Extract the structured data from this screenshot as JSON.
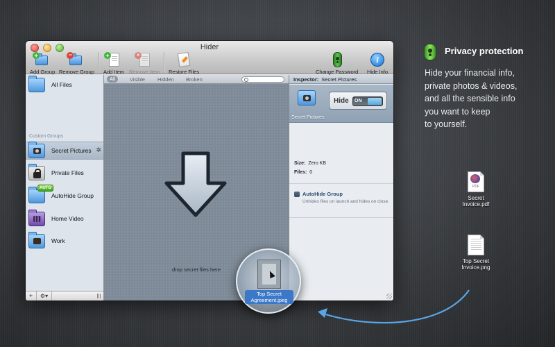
{
  "window": {
    "title": "Hider",
    "toolbar": {
      "add_group": "Add Group",
      "remove_group": "Remove Group",
      "add_item": "Add Item",
      "remove_item": "Remove Item",
      "restore_files": "Restore Files",
      "change_password": "Change Password",
      "hide_info": "Hide Info"
    },
    "sidebar": {
      "all_files": "All Files",
      "group_header": "Custom Groups",
      "items": [
        {
          "label": "Secret Pictures",
          "icon": "camera-folder-icon",
          "selected": true
        },
        {
          "label": "Private Files",
          "icon": "lock-folder-icon"
        },
        {
          "label": "AutoHide Group",
          "icon": "autohide-folder-icon",
          "badge": "AUTO"
        },
        {
          "label": "Home Video",
          "icon": "film-folder-icon"
        },
        {
          "label": "Work",
          "icon": "briefcase-folder-icon"
        }
      ],
      "bottom_add": "+",
      "bottom_gear": "⚙▾"
    },
    "filters": {
      "all": "All",
      "visible": "Visible",
      "hidden": "Hidden",
      "broken": "Broken",
      "search_placeholder": ""
    },
    "drop_text": "drop secret files here",
    "inspector": {
      "header_label": "Inspector:",
      "header_value": "Secret Pictures",
      "folder_name": "Secret Pictures",
      "hide_label": "Hide",
      "toggle_label": "ON",
      "size_label": "Size:",
      "size_value": "Zero KB",
      "files_label": "Files:",
      "files_value": "0",
      "autohide_title": "AutoHide Group",
      "autohide_desc": "Unhides files on launch and hides on close"
    }
  },
  "promo": {
    "title": "Privacy protection",
    "lines": [
      "Hide your financial info,",
      "private photos & videos,",
      "and all the sensible info",
      "you want to keep",
      "to yourself."
    ]
  },
  "desktop_files": {
    "pdf": {
      "line1": "Secret",
      "line2": "Invoice.pdf",
      "tag": "PDF"
    },
    "png": {
      "line1": "Top Secret",
      "line2": "Invoice.png"
    }
  },
  "dragged_file": {
    "line1": "Top Secret",
    "line2": "Agreement.jpeg"
  },
  "colors": {
    "accent": "#3b78c7",
    "center_bg": "#7e8a97",
    "inspector_title": "#2b4b73"
  }
}
